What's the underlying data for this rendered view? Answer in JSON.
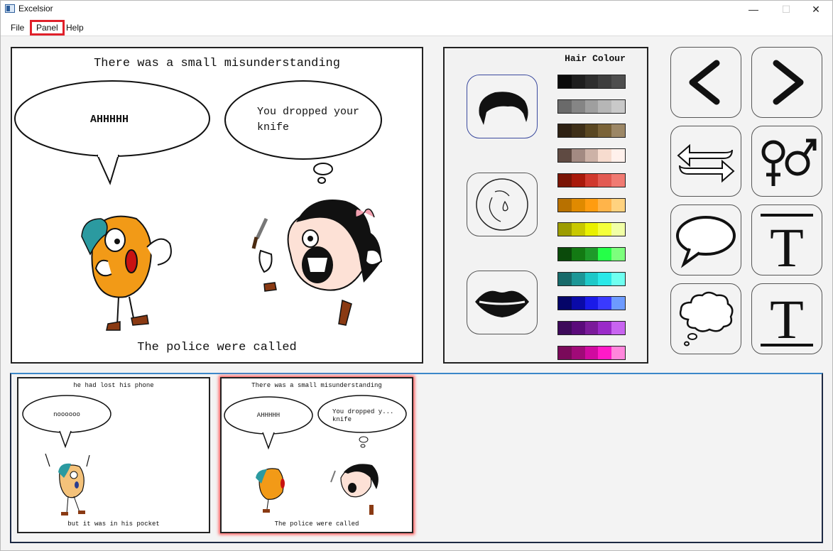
{
  "window": {
    "title": "Excelsior",
    "minimize_glyph": "—",
    "maximize_glyph": "☐",
    "close_glyph": "✕"
  },
  "menu": {
    "file": "File",
    "panel": "Panel",
    "help": "Help"
  },
  "main_panel": {
    "top_caption": "There was a small misunderstanding",
    "bottom_caption": "The police were called",
    "speech_bubble": "AHHHHH",
    "thought_bubble_line1": "You dropped your",
    "thought_bubble_line2": "knife"
  },
  "hair_panel": {
    "title": "Hair Colour",
    "swatch_rows": [
      [
        "#0b0b0b",
        "#1e1e1e",
        "#2e2e2e",
        "#3e3e3e",
        "#4e4e4e"
      ],
      [
        "#6a6a6a",
        "#858585",
        "#9f9f9f",
        "#b6b6b6",
        "#c9c9c9"
      ],
      [
        "#2e2113",
        "#3e2f18",
        "#5a4722",
        "#7a6338",
        "#9c8766"
      ],
      [
        "#5f4a42",
        "#a38a82",
        "#cdb2a7",
        "#f7dccf",
        "#fff1ec"
      ],
      [
        "#7a1405",
        "#a8190a",
        "#d0382d",
        "#e25a52",
        "#f07a72"
      ],
      [
        "#b87100",
        "#e08a00",
        "#ff9c10",
        "#ffb44a",
        "#ffd27f"
      ],
      [
        "#9c9c00",
        "#c8c800",
        "#e9f000",
        "#f4ff3c",
        "#f1ffa6"
      ],
      [
        "#0a4a0a",
        "#137a13",
        "#1e9a2a",
        "#25ff48",
        "#7dff7d"
      ],
      [
        "#176a6a",
        "#1c9696",
        "#1ec8c8",
        "#2ae8e8",
        "#6ffff0"
      ],
      [
        "#050568",
        "#0a0aa8",
        "#1a1ae8",
        "#3a3aff",
        "#6d9aff"
      ],
      [
        "#3d0a5a",
        "#5a0a7a",
        "#7a1a9a",
        "#9a2ac8",
        "#c864f0"
      ],
      [
        "#7a0a5a",
        "#a00a78",
        "#d00aa0",
        "#ff1ac8",
        "#ff86dc"
      ]
    ],
    "options": [
      "hair-icon",
      "face-icon",
      "lips-icon"
    ]
  },
  "tools": [
    "previous-icon",
    "next-icon",
    "swap-icon",
    "gender-icon",
    "speech-bubble-icon",
    "top-text-icon",
    "thought-bubble-icon",
    "bottom-text-icon"
  ],
  "filmstrip": {
    "thumbs": [
      {
        "top_caption": "he had lost his phone",
        "bubble": "noooooo",
        "bottom_caption": "but it was in his pocket"
      },
      {
        "top_caption": "There was a small misunderstanding",
        "bubble_left": "AHHHHH",
        "bubble_right_line1": "You dropped y...",
        "bubble_right_line2": "knife",
        "bottom_caption": "The police were called"
      }
    ]
  }
}
